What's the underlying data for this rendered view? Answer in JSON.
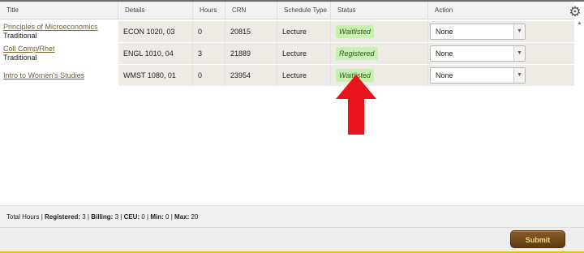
{
  "columns": {
    "title": "Title",
    "details": "Details",
    "hours": "Hours",
    "crn": "CRN",
    "schedule_type": "Schedule Type",
    "status": "Status",
    "action": "Action"
  },
  "rows": [
    {
      "title": "Principles of Microeconomics",
      "subtitle": "Traditional",
      "details": "ECON 1020, 03",
      "hours": "0",
      "crn": "20815",
      "schedule_type": "Lecture",
      "status": "Waitlisted",
      "action": "None"
    },
    {
      "title": "Coll Comp/Rhet",
      "subtitle": "Traditional",
      "details": "ENGL 1010, 04",
      "hours": "3",
      "crn": "21889",
      "schedule_type": "Lecture",
      "status": "Registered",
      "action": "None"
    },
    {
      "title": "Intro to Women's Studies",
      "subtitle": "",
      "details": "WMST 1080, 01",
      "hours": "0",
      "crn": "23954",
      "schedule_type": "Lecture",
      "status": "Waitlisted",
      "action": "None"
    }
  ],
  "totals": {
    "label": "Total Hours",
    "registered_label": "Registered:",
    "registered": "3",
    "billing_label": "Billing:",
    "billing": "3",
    "ceu_label": "CEU:",
    "ceu": "0",
    "min_label": "Min:",
    "min": "0",
    "max_label": "Max:",
    "max": "20"
  },
  "buttons": {
    "submit": "Submit"
  },
  "icons": {
    "settings": "gear-icon",
    "dropdown": "chevron-down-icon",
    "annotation": "red-up-arrow"
  },
  "colors": {
    "status_badge": "#c8f0b0",
    "submit_bg": "#6e4519",
    "annotation_arrow": "#e8141c",
    "link": "#7b6232"
  }
}
